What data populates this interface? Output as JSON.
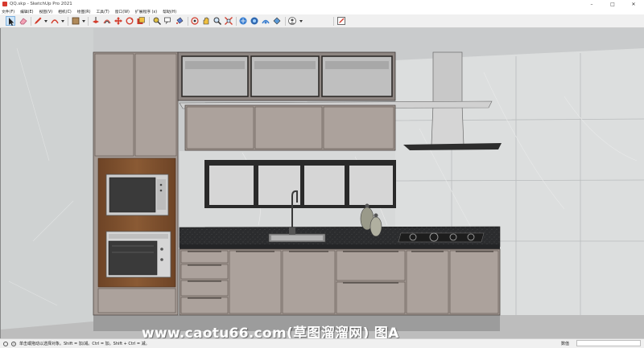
{
  "window": {
    "title": "QQ.skp - SketchUp Pro 2021",
    "controls": {
      "minimize": "–",
      "maximize": "□",
      "close": "✕"
    }
  },
  "menu": [
    {
      "label": "文件(F)"
    },
    {
      "label": "编辑(E)"
    },
    {
      "label": "视图(V)"
    },
    {
      "label": "相机(C)"
    },
    {
      "label": "绘图(R)"
    },
    {
      "label": "工具(T)"
    },
    {
      "label": "窗口(W)"
    },
    {
      "label": "扩展程序 (x)"
    },
    {
      "label": "帮助(H)"
    }
  ],
  "toolbar": {
    "tools": [
      {
        "name": "select-tool",
        "icon": "arrow-cursor-icon",
        "active": true
      },
      {
        "name": "eraser-tool",
        "icon": "eraser-icon"
      },
      {
        "name": "line-tool",
        "icon": "pencil-icon"
      },
      {
        "name": "arc-tool",
        "icon": "arc-icon"
      },
      {
        "name": "rectangle-tool",
        "icon": "rectangle-icon"
      },
      {
        "name": "push-pull-tool",
        "icon": "push-pull-icon"
      },
      {
        "name": "offset-tool",
        "icon": "offset-icon"
      },
      {
        "name": "move-tool",
        "icon": "move-icon"
      },
      {
        "name": "rotate-tool",
        "icon": "rotate-icon"
      },
      {
        "name": "scale-tool",
        "icon": "scale-icon"
      },
      {
        "name": "tape-measure-tool",
        "icon": "tape-measure-icon"
      },
      {
        "name": "text-tool",
        "icon": "text-icon"
      },
      {
        "name": "paint-bucket-tool",
        "icon": "paint-bucket-icon"
      },
      {
        "name": "orbit-tool",
        "icon": "orbit-icon"
      },
      {
        "name": "pan-tool",
        "icon": "pan-hand-icon"
      },
      {
        "name": "zoom-tool",
        "icon": "zoom-icon"
      },
      {
        "name": "zoom-extents-tool",
        "icon": "zoom-extents-icon"
      },
      {
        "name": "warehouse-tool",
        "icon": "warehouse-icon"
      },
      {
        "name": "extension-warehouse-tool",
        "icon": "extension-warehouse-icon"
      },
      {
        "name": "layout-tool",
        "icon": "layout-icon"
      },
      {
        "name": "extension-manager-tool",
        "icon": "extension-manager-icon"
      },
      {
        "name": "account-tool",
        "icon": "account-icon"
      },
      {
        "name": "style-tool",
        "icon": "style-edit-icon"
      }
    ]
  },
  "watermark": "www.caotu66.com(草图溜溜网) 图A",
  "status": {
    "hint": "单击或拖动以选择对象。Shift = 加/减。Ctrl = 加。Shift + Ctrl = 减。",
    "measurements_label": "数值",
    "measurements_value": ""
  },
  "colors": {
    "sky": "#9aa6ae",
    "wall": "#d9dcdc",
    "cabinet": "#a49a94",
    "cabinet_edge": "#5a524d",
    "countertop": "#2b2c2e",
    "wood": "#7a4a2a",
    "glass": "#bfbfbf"
  }
}
